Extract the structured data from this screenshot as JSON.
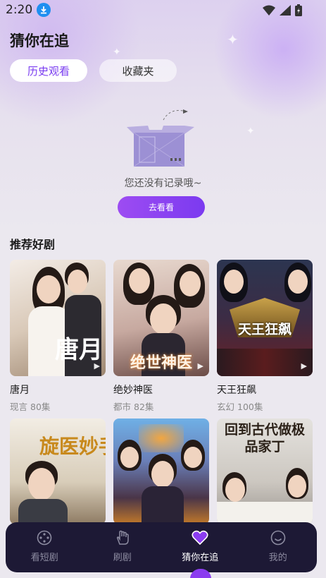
{
  "status_bar": {
    "time": "2:20",
    "icons": [
      "download-badge-icon",
      "wifi-icon",
      "signal-icon",
      "battery-icon"
    ]
  },
  "header": {
    "title": "猜你在追"
  },
  "tabs": [
    {
      "label": "历史观看",
      "active": true
    },
    {
      "label": "收藏夹",
      "active": false
    }
  ],
  "empty_state": {
    "message": "您还没有记录哦~",
    "button_label": "去看看"
  },
  "recommend": {
    "title": "推荐好剧",
    "items": [
      {
        "title": "唐月",
        "genre": "现言",
        "episodes": "80集",
        "poster_text": "唐月"
      },
      {
        "title": "绝妙神医",
        "genre": "都市",
        "episodes": "82集",
        "poster_text": "绝世神医"
      },
      {
        "title": "天王狂飙",
        "genre": "玄幻",
        "episodes": "100集",
        "poster_text": "天王狂飙"
      },
      {
        "poster_text": "旋医妙手"
      },
      {
        "poster_text": ""
      },
      {
        "poster_text": "回到古代做极品家丁"
      }
    ]
  },
  "tabbar": {
    "items": [
      {
        "label": "看短剧",
        "icon": "film-reel-icon",
        "active": false
      },
      {
        "label": "刷剧",
        "icon": "hand-icon",
        "active": false
      },
      {
        "label": "猜你在追",
        "icon": "heart-icon",
        "active": true
      },
      {
        "label": "我的",
        "icon": "smile-icon",
        "active": false
      }
    ]
  },
  "colors": {
    "accent": "#8b3cf0",
    "tabbar_bg": "#1d1935",
    "page_bg": "#ebe8ef"
  }
}
